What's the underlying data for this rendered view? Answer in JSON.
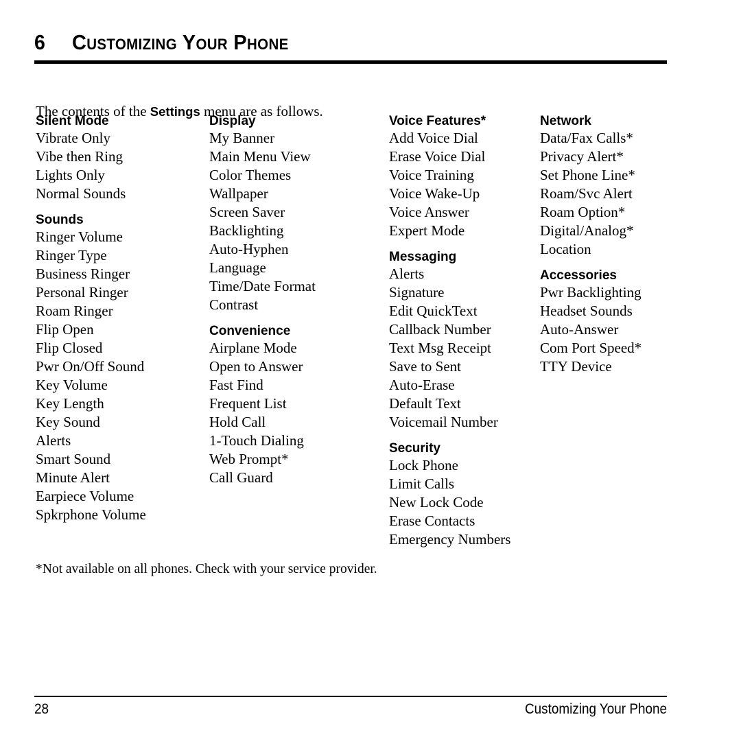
{
  "header": {
    "chapter_number": "6",
    "chapter_title": "Customizing Your Phone"
  },
  "intro": {
    "before": "The contents of the ",
    "keyword": "Settings",
    "after": " menu are as follows."
  },
  "columns": [
    {
      "sections": [
        {
          "heading": "Silent Mode",
          "items": [
            "Vibrate Only",
            "Vibe then Ring",
            "Lights Only",
            "Normal Sounds"
          ]
        },
        {
          "heading": "Sounds",
          "items": [
            "Ringer Volume",
            "Ringer Type",
            "Business Ringer",
            "Personal Ringer",
            "Roam Ringer",
            "Flip Open",
            "Flip Closed",
            "Pwr On/Off Sound",
            "Key Volume",
            "Key Length",
            "Key Sound",
            "Alerts",
            "Smart Sound",
            "Minute Alert",
            "Earpiece Volume",
            "Spkrphone Volume"
          ]
        }
      ]
    },
    {
      "sections": [
        {
          "heading": "Display",
          "items": [
            "My Banner",
            "Main Menu View",
            "Color Themes",
            "Wallpaper",
            "Screen Saver",
            "Backlighting",
            "Auto-Hyphen",
            "Language",
            "Time/Date Format",
            "Contrast"
          ]
        },
        {
          "heading": "Convenience",
          "items": [
            "Airplane Mode",
            "Open to Answer",
            "Fast Find",
            "Frequent List",
            "Hold Call",
            "1-Touch Dialing",
            "Web Prompt*",
            "Call Guard"
          ]
        }
      ]
    },
    {
      "sections": [
        {
          "heading": "Voice Features*",
          "items": [
            "Add Voice Dial",
            "Erase Voice Dial",
            "Voice Training",
            "Voice Wake-Up",
            "Voice Answer",
            "Expert Mode"
          ]
        },
        {
          "heading": "Messaging",
          "items": [
            "Alerts",
            "Signature",
            "Edit QuickText",
            "Callback Number",
            "Text Msg Receipt",
            "Save to Sent",
            "Auto-Erase",
            "Default Text",
            "Voicemail Number"
          ]
        },
        {
          "heading": "Security",
          "items": [
            "Lock Phone",
            "Limit Calls",
            "New Lock Code",
            "Erase Contacts",
            "Emergency Numbers"
          ]
        }
      ]
    },
    {
      "sections": [
        {
          "heading": "Network",
          "items": [
            "Data/Fax Calls*",
            "Privacy Alert*",
            "Set Phone Line*",
            "Roam/Svc Alert",
            "Roam Option*",
            "Digital/Analog*",
            "Location"
          ]
        },
        {
          "heading": "Accessories",
          "items": [
            "Pwr Backlighting",
            "Headset Sounds",
            "Auto-Answer",
            "Com Port Speed*",
            "TTY Device"
          ]
        }
      ]
    }
  ],
  "footnote": "*Not available on all phones. Check with your service provider.",
  "footer": {
    "page_number": "28",
    "chapter_name": "Customizing Your Phone"
  }
}
